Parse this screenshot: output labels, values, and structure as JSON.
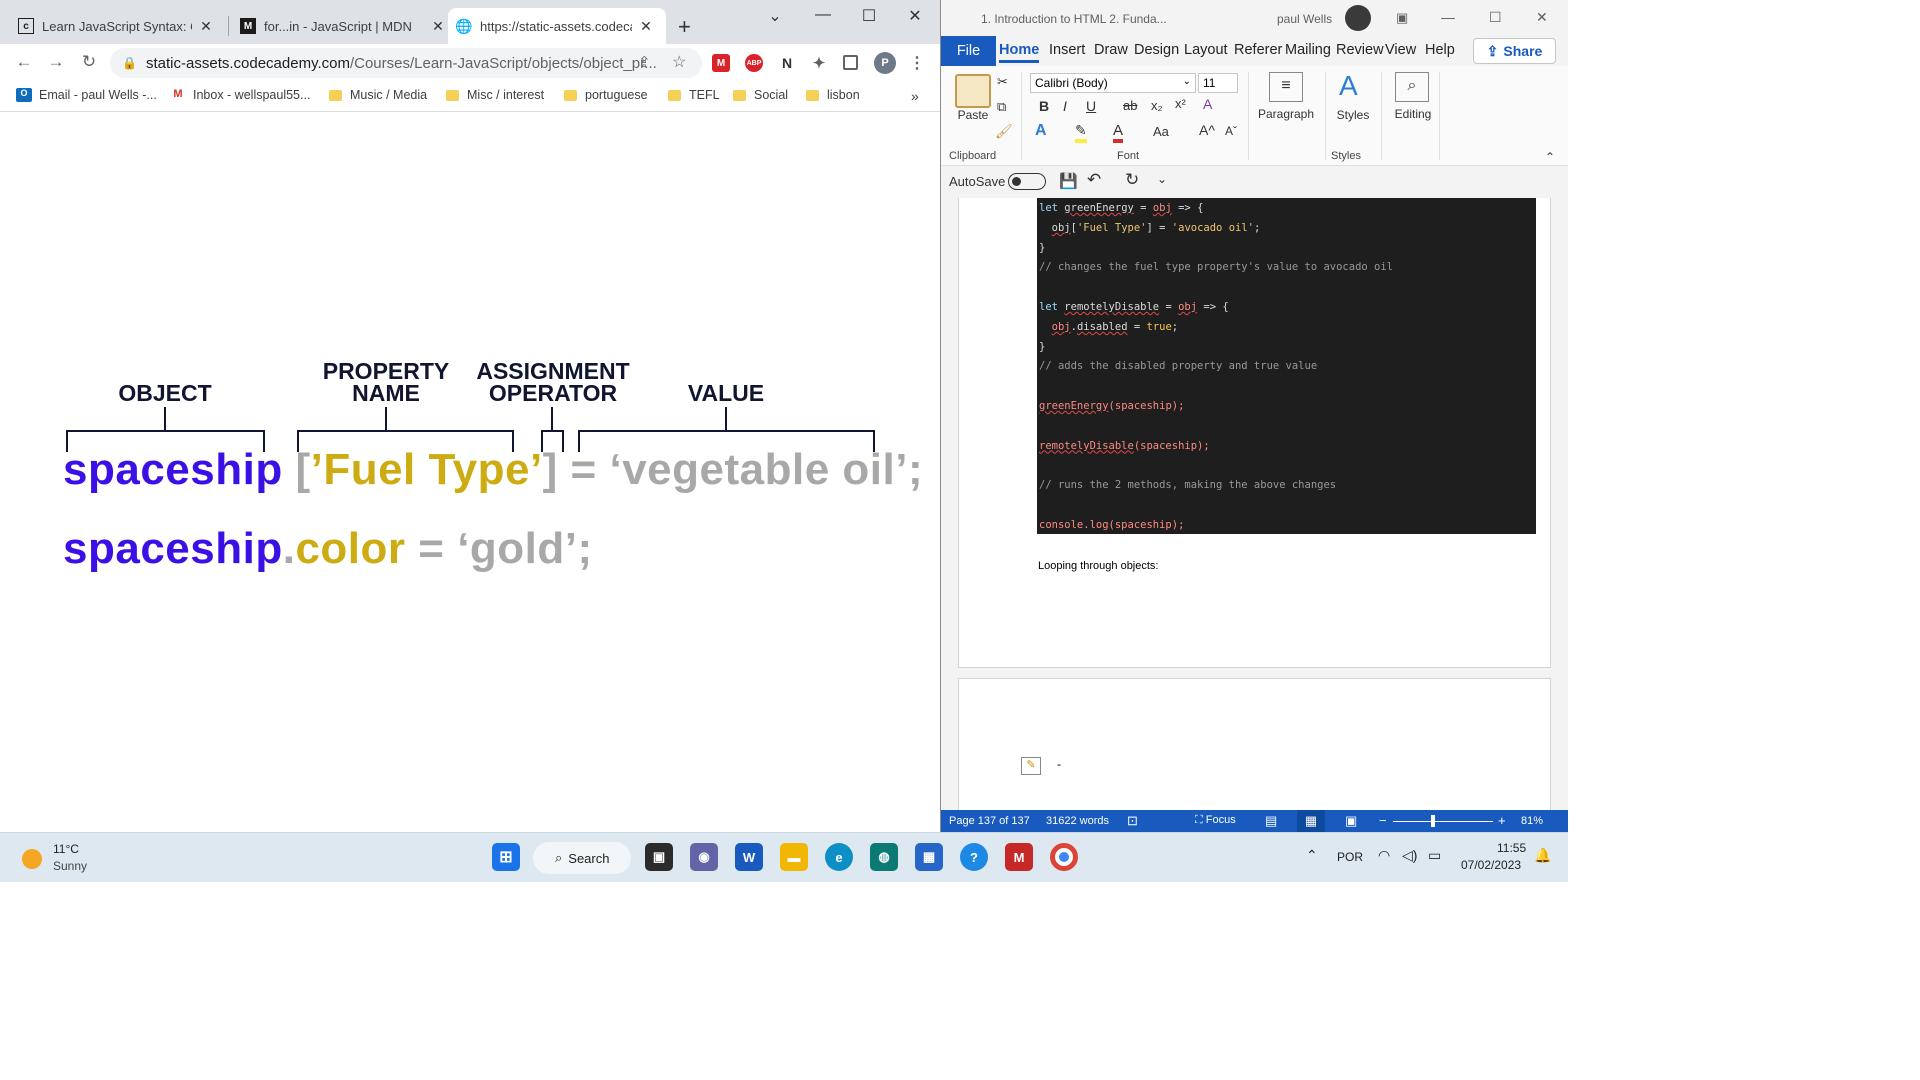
{
  "browser": {
    "tabs": [
      {
        "title": "Learn JavaScript Syntax: Obje",
        "icon": "codecademy-icon"
      },
      {
        "title": "for...in - JavaScript | MDN",
        "icon": "mdn-icon"
      },
      {
        "title": "https://static-assets.codecad",
        "icon": "globe-icon"
      }
    ],
    "new_tab": "+",
    "url_domain": "static-assets.codecademy.com",
    "url_path": "/Courses/Learn-JavaScript/objects/object_pr...",
    "profile_initial": "P",
    "bookmarks": [
      {
        "label": "Email - paul Wells -...",
        "icon": "outlook-icon"
      },
      {
        "label": "Inbox - wellspaul55...",
        "icon": "gmail-icon"
      },
      {
        "label": "Music / Media",
        "icon": "folder-icon"
      },
      {
        "label": "Misc / interest",
        "icon": "folder-icon"
      },
      {
        "label": "portuguese",
        "icon": "folder-icon"
      },
      {
        "label": "TEFL",
        "icon": "folder-icon"
      },
      {
        "label": "Social",
        "icon": "folder-icon"
      },
      {
        "label": "lisbon",
        "icon": "folder-icon"
      }
    ],
    "bookmarks_more": "»"
  },
  "diagram": {
    "labels": {
      "object": "OBJECT",
      "property_name_1": "PROPERTY",
      "property_name_2": "NAME",
      "assignment_1": "ASSIGNMENT",
      "assignment_2": "OPERATOR",
      "value": "VALUE"
    },
    "line1": {
      "object": "spaceship",
      "open": " [",
      "prop": "’Fuel Type’",
      "close": "]",
      "assign": " = ",
      "value": "‘vegetable oil’;"
    },
    "line2": {
      "object": "spaceship",
      "dot": ".",
      "prop": "color",
      "assign": " = ",
      "value": "‘gold’;"
    },
    "colors": {
      "object": "#3a10e5",
      "property": "#ccac12",
      "gray": "#a8a8a8",
      "label": "#10162f"
    }
  },
  "word": {
    "title": "1. Introduction to HTML 2. Funda...",
    "user": "paul Wells",
    "tabs": [
      "File",
      "Home",
      "Insert",
      "Draw",
      "Design",
      "Layout",
      "Referer",
      "Mailing",
      "Review",
      "View",
      "Help"
    ],
    "share": "Share",
    "font_name": "Calibri (Body)",
    "font_size": "11",
    "ribbon_buttons": {
      "paste": "Paste",
      "paragraph": "Paragraph",
      "styles": "Styles",
      "editing": "Editing"
    },
    "groups": {
      "clipboard": "Clipboard",
      "font": "Font",
      "styles": "Styles"
    },
    "autosave": "AutoSave",
    "code_lines": [
      "let greenEnergy = obj => {",
      "  obj['Fuel Type'] = 'avocado oil';",
      "}",
      "// changes the fuel type property's value to avocado oil",
      "",
      "let remotelyDisable = obj => {",
      "  obj.disabled = true;",
      "}",
      "// adds the disabled property and true value",
      "",
      "greenEnergy(spaceship);",
      "",
      "remotelyDisable(spaceship);",
      "",
      "// runs the 2 methods, making the above changes",
      "",
      "console.log(spaceship);"
    ],
    "body_text": "Looping through objects:",
    "status": {
      "page": "Page 137 of 137",
      "words": "31622 words",
      "focus": "Focus",
      "zoom": "81%"
    }
  },
  "taskbar": {
    "weather_temp": "11°C",
    "weather_desc": "Sunny",
    "search": "Search",
    "lang": "POR",
    "time": "11:55",
    "date": "07/02/2023"
  }
}
